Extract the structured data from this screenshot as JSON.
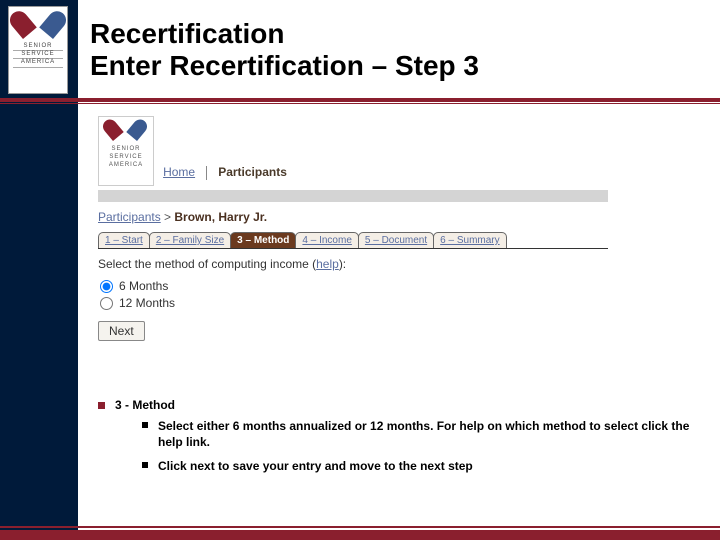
{
  "logo": {
    "l1": "SENIOR",
    "l2": "SERVICE",
    "l3": "AMERICA"
  },
  "title_line1": "Recertification",
  "title_line2": "Enter Recertification – Step 3",
  "nav": {
    "home": "Home",
    "participants": "Participants"
  },
  "breadcrumb": {
    "root": "Participants",
    "sep": " > ",
    "name": "Brown, Harry Jr."
  },
  "tabs": [
    "1 – Start",
    "2 – Family Size",
    "3 – Method",
    "4 – Income",
    "5 – Document",
    "6 – Summary"
  ],
  "instruction_pre": "Select the method of computing income (",
  "instruction_help": "help",
  "instruction_post": "):",
  "options": {
    "six": "6 Months",
    "twelve": "12 Months"
  },
  "next_label": "Next",
  "notes": {
    "heading": "3 - Method",
    "items": [
      "Select either 6 months annualized or 12 months.  For help on which method to select click the help link.",
      "Click next to save your entry and move to the next step"
    ]
  }
}
